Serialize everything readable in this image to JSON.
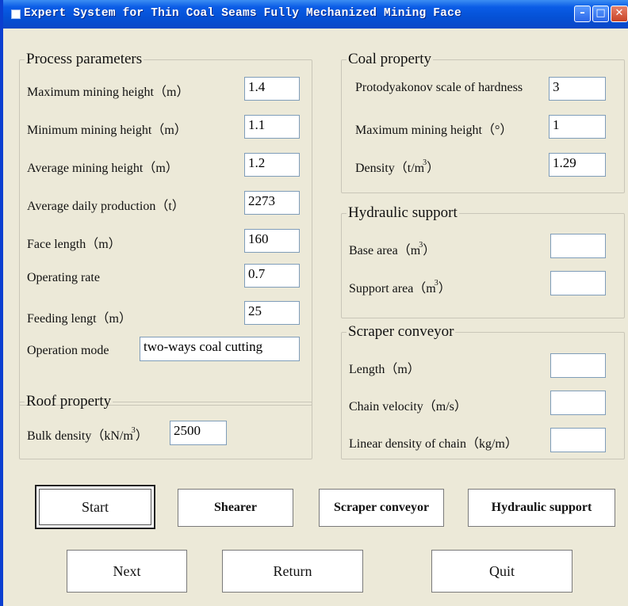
{
  "window": {
    "title": "Expert System for Thin Coal Seams Fully Mechanized Mining Face"
  },
  "process": {
    "legend": "Process parameters",
    "max_height_label": "Maximum mining height（m）",
    "max_height_value": "1.4",
    "min_height_label": "Minimum mining height（m）",
    "min_height_value": "1.1",
    "avg_height_label": "Average mining height（m）",
    "avg_height_value": "1.2",
    "daily_prod_label": "Average daily production（t）",
    "daily_prod_value": "2273",
    "face_length_label": "Face length（m）",
    "face_length_value": "160",
    "operating_rate_label": "Operating rate",
    "operating_rate_value": "0.7",
    "feeding_label": "Feeding lengt（m）",
    "feeding_value": "25",
    "operation_mode_label": "Operation mode",
    "operation_mode_value": "two-ways coal cutting"
  },
  "roof": {
    "legend": "Roof property",
    "bulk_density_label": "Bulk density（kN/m",
    "bulk_density_sup": "3",
    "bulk_density_close": "）",
    "bulk_density_value": "2500"
  },
  "coal": {
    "legend": "Coal property",
    "hardness_label": "Protodyakonov scale of hardness",
    "hardness_value": "3",
    "max_height_label": "Maximum mining height（°）",
    "max_height_value": "1",
    "density_label": "Density（t/m",
    "density_sup": "3",
    "density_close": "）",
    "density_value": "1.29"
  },
  "hydraulic": {
    "legend": "Hydraulic support",
    "base_area_label": "Base area（m",
    "base_area_sup": "3",
    "base_area_close": "）",
    "base_area_value": "",
    "support_area_label": "Support area（m",
    "support_area_sup": "3",
    "support_area_close": "）",
    "support_area_value": ""
  },
  "scraper": {
    "legend": "Scraper conveyor",
    "length_label": "Length（m）",
    "length_value": "",
    "chain_velocity_label": "Chain velocity（m/s）",
    "chain_velocity_value": "",
    "linear_density_label": "Linear density of chain（kg/m）",
    "linear_density_value": ""
  },
  "buttons": {
    "start": "Start",
    "shearer": "Shearer",
    "scraper_conveyor": "Scraper conveyor",
    "hydraulic_support": "Hydraulic support",
    "next": "Next",
    "return": "Return",
    "quit": "Quit"
  }
}
